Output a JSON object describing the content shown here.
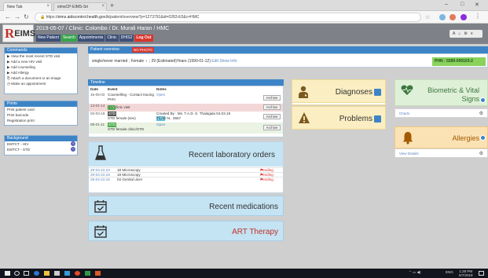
{
  "browser": {
    "tab1_title": "New Tab",
    "tab2_title": "eimsCP-EIMS-Sri",
    "url_prefix": "https://",
    "url_host": "eims.aidscontrol.health.gov.lk",
    "url_rest": "/patient/overview?p=1273791&id=0283-E5&c=HMC"
  },
  "app": {
    "logo_mark": "R",
    "logo_text": "EIMS",
    "breadcrumb": "2019-05-07  /  Clinic: Colombo  /  Dr. Murali Haran  /  HMC",
    "nav_buttons": [
      "New Patient",
      "Search",
      "Appointments",
      "Clinic",
      "DHIS2",
      "Log Out"
    ]
  },
  "left": {
    "commands_title": "Commands",
    "commands": [
      "View the most recent STD visit",
      "Add a new HIV visit",
      "Add counseling",
      "Add Allergy",
      "Attach a document or an image",
      "Make an appointment"
    ],
    "prints_title": "Prints",
    "prints": [
      "Print patient card",
      "Print barcode",
      "Registration print"
    ],
    "background_title": "Background",
    "background": [
      {
        "label": "EMTCT - HIV",
        "count": "+"
      },
      {
        "label": "EMTCT - STD",
        "count": "+"
      }
    ]
  },
  "patient": {
    "header_label": "Patient overview",
    "header_tag": "NO PHOTO",
    "info_text": "single/never married ; Female ♀ ; 29 (Estimated)Years (1990-01-12)",
    "edit_link": "Edit",
    "show_info_link": "Show Info",
    "phn": "PHN : 0289-000103-2"
  },
  "timeline": {
    "title": "Timeline",
    "col_date": "Date",
    "col_event": "Event",
    "col_notes": "Notes",
    "rows": [
      {
        "date": "15-05-02",
        "event": "Counselling - Contact tracing PHN",
        "event2": "",
        "notes": "Open",
        "notes2": "",
        "action": "Archive",
        "tag": ""
      },
      {
        "date": "13-01-14",
        "event": "HIV clinic visit",
        "event2": "",
        "notes": "",
        "notes2": "",
        "action": "Archive",
        "tag": "green"
      },
      {
        "date": "03-03-18",
        "event": "STD female (sex)",
        "event2": "",
        "notes": "Created By : Ms. T.A.D. S. Thalagala 04.03.18",
        "notes2": "TCAD N.. 3557",
        "action": "Archive",
        "tag": "dark"
      },
      {
        "date": "08-01-11",
        "event": "STD female clinic/STD",
        "event2": "",
        "notes": "Open",
        "notes2": "",
        "action": "Archive",
        "tag": "green"
      }
    ]
  },
  "lab": {
    "title": "Recent laboratory orders",
    "rows": [
      {
        "date": "29-04-22.23",
        "name": "18 Microscopy",
        "status": "Pending"
      },
      {
        "date": "29-04-22.18",
        "name": "18 Microscopy",
        "status": "Pending"
      },
      {
        "date": "29-04-22.15",
        "name": "04 Genital ulcer",
        "status": "Pending"
      }
    ]
  },
  "medications": {
    "title": "Recent medications"
  },
  "art": {
    "title": "ART Therapy"
  },
  "diagnoses": {
    "title": "Diagnoses"
  },
  "problems": {
    "title": "Problems"
  },
  "biometric": {
    "title_line1": "Biometric & Vital",
    "title_line2": "Signs",
    "sub": "Charts"
  },
  "allergies": {
    "title": "Allergies",
    "sub": "View Details"
  },
  "taskbar": {
    "time": "1:28 PM",
    "date": "5/7/2019",
    "lang": "ENG"
  },
  "colors": {
    "accent_blue": "#3d84c6",
    "alert_red": "#d9342b",
    "phn_green": "#8ad25c"
  }
}
